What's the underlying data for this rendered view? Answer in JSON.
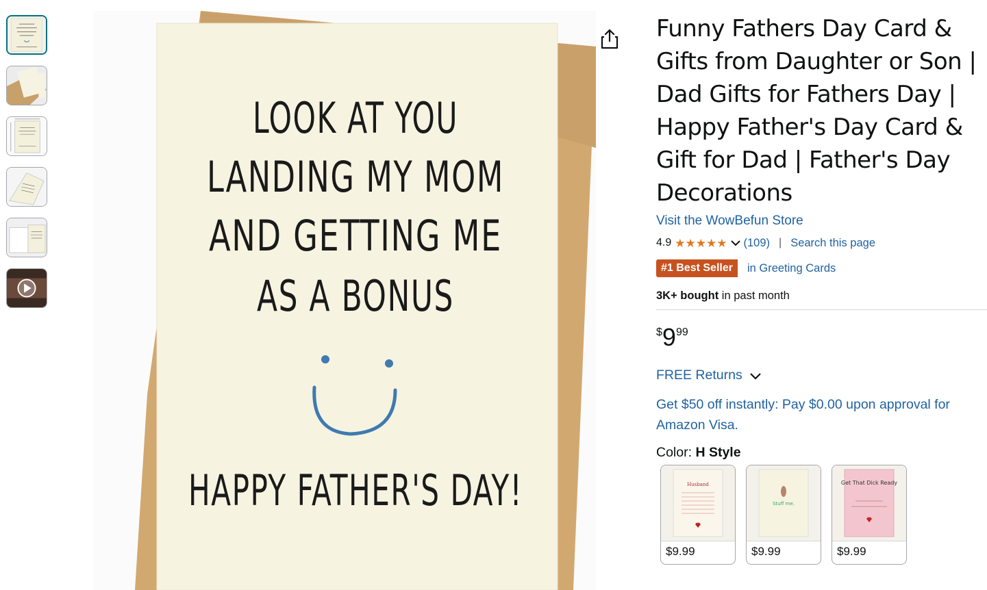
{
  "thumbnails": [
    {
      "name": "thumb-card-front",
      "active": true
    },
    {
      "name": "thumb-card-envelope",
      "active": false
    },
    {
      "name": "thumb-card-dimensions",
      "active": false
    },
    {
      "name": "thumb-card-angled",
      "active": false
    },
    {
      "name": "thumb-card-open",
      "active": false
    },
    {
      "name": "thumb-video",
      "active": false
    }
  ],
  "main_image": {
    "card_lines": [
      "LOOK AT YOU",
      "LANDING MY MOM",
      "AND GETTING ME",
      "AS A BONUS"
    ],
    "card_footer": "HAPPY FATHER'S DAY!"
  },
  "product": {
    "title": "Funny Fathers Day Card & Gifts from Daughter or Son | Dad Gifts for Fathers Day | Happy Father's Day Card & Gift for Dad | Father's Day Decorations",
    "store_link": "Visit the WowBefun Store",
    "rating": "4.9",
    "stars": 5,
    "review_count": "(109)",
    "separator": "|",
    "search_page": "Search this page",
    "badge": "#1 Best Seller",
    "badge_category": "in Greeting Cards",
    "bought_bold": "3K+ bought",
    "bought_rest": " in past month",
    "price": {
      "symbol": "$",
      "whole": "9",
      "fraction": "99"
    },
    "returns": "FREE Returns",
    "promo": "Get $50 off instantly: Pay $0.00 upon approval for Amazon Visa.",
    "color_label": "Color: ",
    "color_value": "H Style",
    "swatches": [
      {
        "price": "$9.99",
        "mini_title": "Husband"
      },
      {
        "price": "$9.99",
        "mini_title": "Stuff me."
      },
      {
        "price": "$9.99",
        "mini_title": "Get That Dick Ready"
      }
    ]
  },
  "colors": {
    "link": "#2162a1",
    "star": "#de7921",
    "badge": "#c7511f",
    "smile": "#3f7ab0"
  }
}
